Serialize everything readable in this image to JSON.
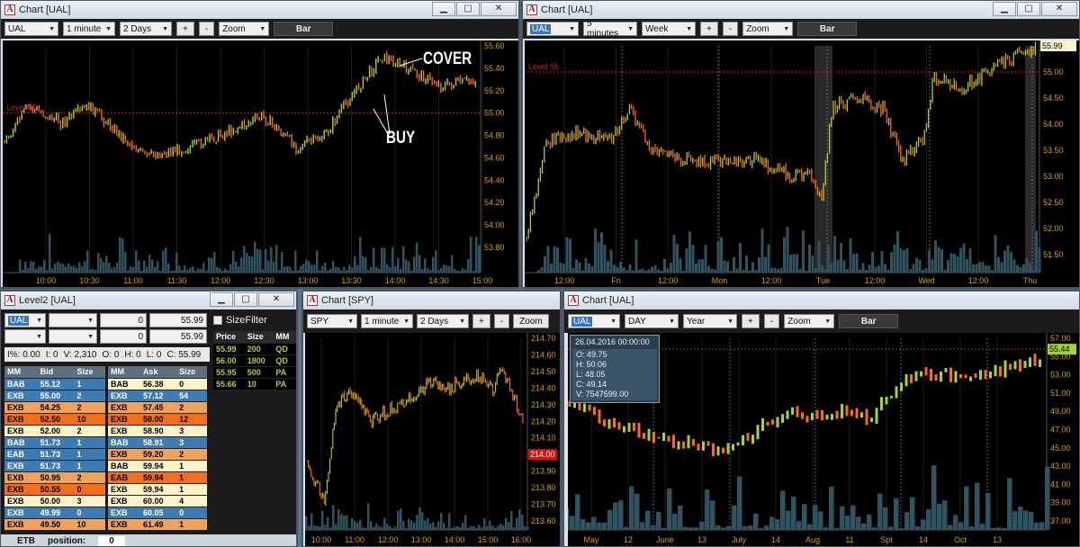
{
  "colors": {
    "up": "#a5d23a",
    "down": "#ff6a12",
    "level": "#d02020",
    "vol": "#2f5360",
    "axis": "#d6a000",
    "blue": "#3d7bb5",
    "orange": "#f0a258",
    "deep": "#f36f1c",
    "cream": "#fdf2c8"
  },
  "windows": {
    "chart1": {
      "title": "Chart [UAL]",
      "symbol": "UAL",
      "interval": "1 minute",
      "range": "2 Days",
      "zoom": "Zoom",
      "style": "Bar",
      "plus": "+",
      "minus": "-",
      "level_label": "Level 55",
      "note_cover": "COVER",
      "note_buy": "BUY",
      "y_ticks": [
        "55.60",
        "55.40",
        "55.20",
        "55.00",
        "54.80",
        "54.60",
        "54.40",
        "54.20",
        "54.00",
        "53.80"
      ],
      "x_ticks": [
        "10:00",
        "10:30",
        "11:00",
        "11:30",
        "12:00",
        "12:30",
        "13:00",
        "13:30",
        "14:00",
        "14:30",
        "15:00"
      ]
    },
    "chart2": {
      "title": "Chart [UAL]",
      "symbol": "UAL",
      "interval": "5 minutes",
      "range": "Week",
      "zoom": "Zoom",
      "style": "Bar",
      "plus": "+",
      "minus": "-",
      "level_label": "Level 55",
      "last_price": "55.99",
      "y_ticks": [
        "55.50",
        "55.00",
        "54.50",
        "54.00",
        "53.50",
        "53.00",
        "52.50",
        "52.00",
        "51.50"
      ],
      "x_ticks": [
        "12:00",
        "Fri",
        "12:00",
        "Mon",
        "12:00",
        "Tue",
        "12:00",
        "Wed",
        "12:00",
        "Thu"
      ]
    },
    "level2": {
      "title": "Level2 [UAL]",
      "symbol": "UAL",
      "qty1": "0",
      "price1": "55.99",
      "qty2": "0",
      "price2": "55.99",
      "size_filter": "SizeFilter",
      "stats": {
        "pct": "I%: 0.00",
        "i": "I: 0",
        "v": "V: 2,310",
        "o": "O: 0",
        "h": "H: 0",
        "l": "L: 0",
        "c": "C: 55.99"
      },
      "trades_headers": [
        "Price",
        "Size",
        "MM"
      ],
      "trades": [
        [
          "55.99",
          "200",
          "QD"
        ],
        [
          "56.00",
          "1800",
          "QD"
        ],
        [
          "55.95",
          "500",
          "PA"
        ],
        [
          "55.66",
          "10",
          "PA"
        ]
      ],
      "bid_headers": [
        "MM",
        "Bid",
        "Size"
      ],
      "ask_headers": [
        "MM",
        "Ask",
        "Size"
      ],
      "bids": [
        [
          "BAB",
          "55.12",
          "1"
        ],
        [
          "EXB",
          "55.00",
          "2"
        ],
        [
          "EXB",
          "54.25",
          "2"
        ],
        [
          "EXB",
          "52.50",
          "10"
        ],
        [
          "EXB",
          "52.00",
          "2"
        ],
        [
          "BAB",
          "51.73",
          "1"
        ],
        [
          "EAB",
          "51.73",
          "1"
        ],
        [
          "EXB",
          "51.73",
          "1"
        ],
        [
          "EXB",
          "50.95",
          "2"
        ],
        [
          "EXB",
          "50.55",
          "0"
        ],
        [
          "EXB",
          "50.00",
          "3"
        ],
        [
          "EXB",
          "49.99",
          "0"
        ],
        [
          "EXB",
          "49.50",
          "10"
        ]
      ],
      "asks": [
        [
          "BAB",
          "56.38",
          "0"
        ],
        [
          "EXB",
          "57.12",
          "54"
        ],
        [
          "EXB",
          "57.45",
          "2"
        ],
        [
          "EXB",
          "58.00",
          "12"
        ],
        [
          "EXB",
          "58.90",
          "3"
        ],
        [
          "BAB",
          "58.91",
          "3"
        ],
        [
          "EXB",
          "59.20",
          "2"
        ],
        [
          "BAB",
          "59.94",
          "1"
        ],
        [
          "EAB",
          "59.94",
          "1"
        ],
        [
          "EXB",
          "59.94",
          "1"
        ],
        [
          "EXB",
          "60.00",
          "4"
        ],
        [
          "EXB",
          "60.05",
          "0"
        ],
        [
          "EXB",
          "61.49",
          "1"
        ]
      ],
      "footer_etb": "ETB",
      "footer_pos_label": "position:",
      "footer_pos": "0"
    },
    "chart3": {
      "title": "Chart [SPY]",
      "symbol": "SPY",
      "interval": "1 minute",
      "range": "2 Days",
      "zoom": "Zoom",
      "plus": "+",
      "minus": "-",
      "last_price": "214.00",
      "y_ticks": [
        "214.70",
        "214.60",
        "214.50",
        "214.40",
        "214.30",
        "214.20",
        "214.10",
        "214.00",
        "213.90",
        "213.80",
        "213.70",
        "213.60"
      ],
      "x_ticks": [
        "10:00",
        "11:00",
        "12:00",
        "13:00",
        "14:00",
        "15:00",
        "16:00"
      ]
    },
    "chart4": {
      "title": "Chart [UAL]",
      "symbol": "UAL",
      "interval": "DAY",
      "range": "Year",
      "zoom": "Zoom",
      "style": "Bar",
      "plus": "+",
      "minus": "-",
      "last_price": "55.44",
      "tooltip": {
        "date": "26.04.2016 00:00:00",
        "o": "O: 49.75",
        "h": "H: 50.06",
        "l": "L: 48.05",
        "c": "C: 49.14",
        "v": "V: 7547599.00"
      },
      "y_ticks": [
        "57.00",
        "55.00",
        "53.00",
        "51.00",
        "49.00",
        "47.00",
        "45.00",
        "43.00",
        "41.00",
        "39.00",
        "37.00"
      ],
      "x_ticks": [
        "May",
        "12",
        "June",
        "13",
        "July",
        "14",
        "Aug",
        "11",
        "Spt",
        "14",
        "Oct",
        "13"
      ]
    }
  }
}
